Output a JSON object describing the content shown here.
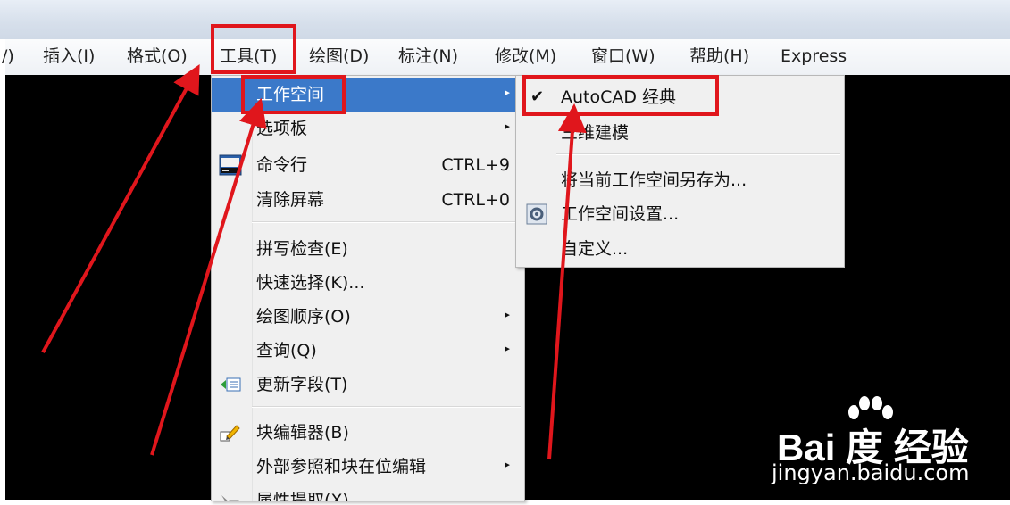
{
  "menubar": {
    "items": [
      {
        "label": "/)"
      },
      {
        "label": "插入(I)"
      },
      {
        "label": "格式(O)"
      },
      {
        "label": "工具(T)"
      },
      {
        "label": "绘图(D)"
      },
      {
        "label": "标注(N)"
      },
      {
        "label": "修改(M)"
      },
      {
        "label": "窗口(W)"
      },
      {
        "label": "帮助(H)"
      },
      {
        "label": "Express"
      }
    ]
  },
  "tools_menu": {
    "items": [
      {
        "label": "工作空间",
        "shortcut": "",
        "submenu": true
      },
      {
        "label": "选项板",
        "shortcut": "",
        "submenu": true
      },
      {
        "label": "命令行",
        "shortcut": "CTRL+9",
        "submenu": false,
        "icon": "command-line-icon"
      },
      {
        "label": "清除屏幕",
        "shortcut": "CTRL+0",
        "submenu": false
      },
      {
        "label": "拼写检查(E)",
        "shortcut": "",
        "submenu": false
      },
      {
        "label": "快速选择(K)...",
        "shortcut": "",
        "submenu": false
      },
      {
        "label": "绘图顺序(O)",
        "shortcut": "",
        "submenu": true
      },
      {
        "label": "查询(Q)",
        "shortcut": "",
        "submenu": true
      },
      {
        "label": "更新字段(T)",
        "shortcut": "",
        "submenu": false,
        "icon": "update-field-icon"
      },
      {
        "label": "块编辑器(B)",
        "shortcut": "",
        "submenu": false,
        "icon": "block-editor-icon"
      },
      {
        "label": "外部参照和块在位编辑",
        "shortcut": "",
        "submenu": true
      },
      {
        "label": "属性提取(X)...",
        "shortcut": "",
        "submenu": false,
        "icon": "attribute-extract-icon"
      }
    ],
    "submenu_arrow": "▸"
  },
  "workspace_submenu": {
    "items": [
      {
        "label": "AutoCAD 经典",
        "checked": true
      },
      {
        "label": "三维建模",
        "checked": false
      },
      {
        "label": "将当前工作空间另存为...",
        "checked": false
      },
      {
        "label": "工作空间设置...",
        "checked": false,
        "icon": "workspace-settings-icon"
      },
      {
        "label": "自定义...",
        "checked": false
      }
    ],
    "check_glyph": "✔"
  },
  "watermark": {
    "logo": "Bai 度 经验",
    "url": "jingyan.baidu.com"
  },
  "colors": {
    "highlight": "#3b79c9",
    "annotation_red": "#e0161c",
    "canvas": "#000000"
  }
}
